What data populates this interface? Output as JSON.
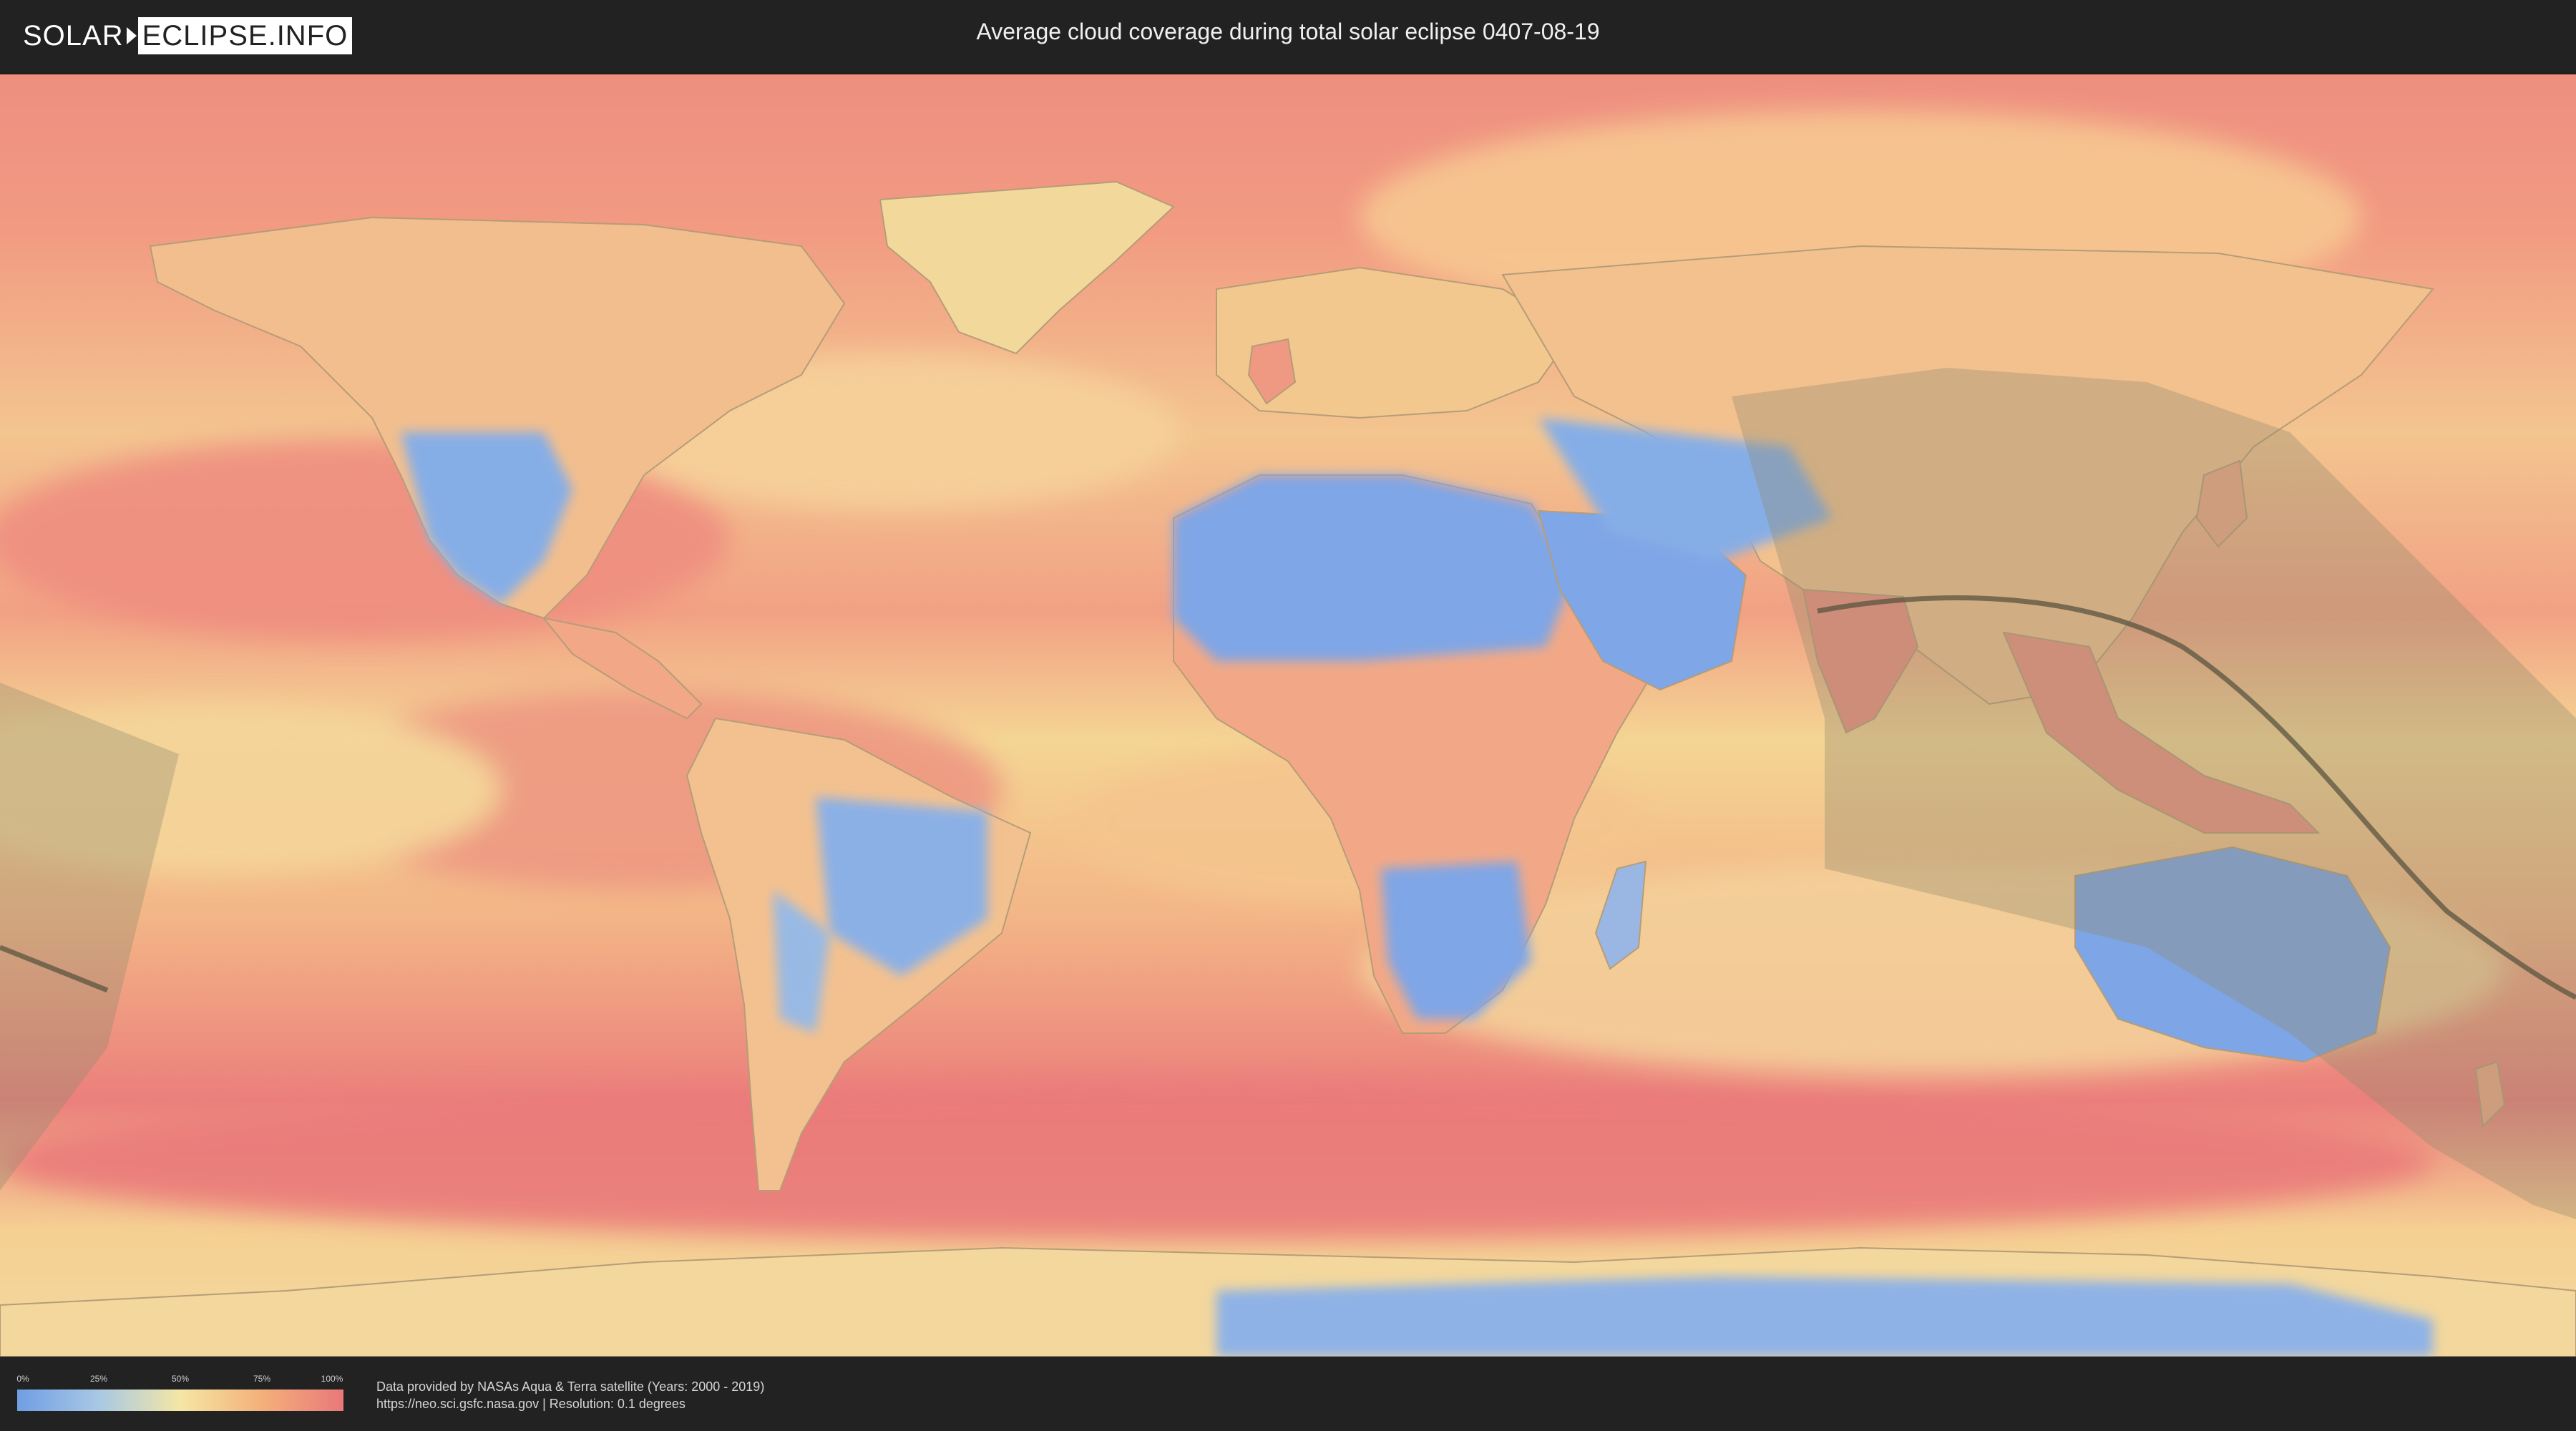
{
  "header": {
    "logo_solar": "SOLAR",
    "logo_eclipse": "ECLIPSE.INFO",
    "title": "Average cloud coverage during total solar eclipse 0407-08-19"
  },
  "map": {
    "colors": {
      "ocean_cloudy": "#ee8a7e",
      "ocean_mid": "#f5c38c",
      "clear_land": "#7fa6e6",
      "partly": "#f3dd9c",
      "border": "#9c8a6a",
      "eclipse_band": "#8f8a6c",
      "central_line": "#5a5440"
    },
    "icons": [
      "eclipse-path-band",
      "central-line"
    ]
  },
  "legend": {
    "ticks": [
      "0%",
      "25%",
      "50%",
      "75%",
      "100%"
    ],
    "gradient": [
      "#6f9ee4",
      "#a8c8e4",
      "#f5e6a5",
      "#f4b07a",
      "#e9787a"
    ]
  },
  "footer": {
    "credit_line_1": "Data provided by NASAs Aqua & Terra satellite (Years: 2000 - 2019)",
    "credit_line_2": "https://neo.sci.gsfc.nasa.gov | Resolution: 0.1 degrees"
  }
}
